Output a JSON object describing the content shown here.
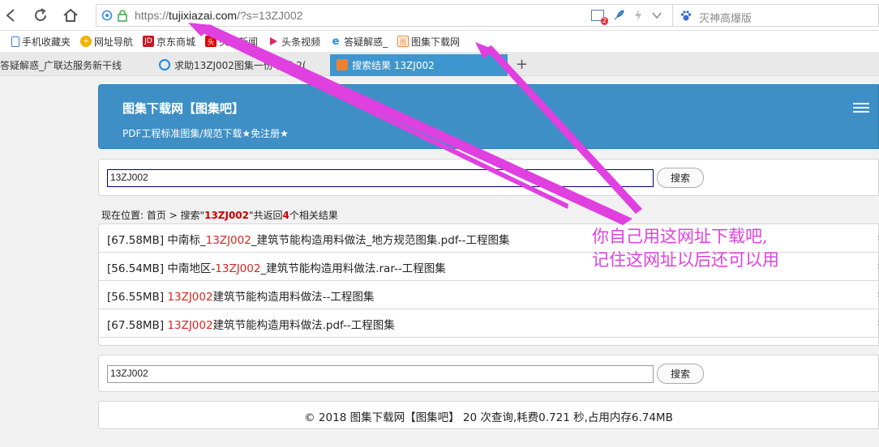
{
  "browser": {
    "url_prefix": "https://",
    "url_host": "tujixiazai.com",
    "url_path": "/?s=13ZJ002",
    "search_engine_text": "灭神高爆版",
    "badge_count": "2"
  },
  "bookmarks": [
    {
      "label": "手机收藏夹",
      "icon": "phone-icon",
      "color": "#3a7bd5"
    },
    {
      "label": "网址导航",
      "icon": "navigation-icon",
      "color": "#f0b400"
    },
    {
      "label": "京东商城",
      "icon": "jd-logo-icon",
      "color": "#c81623"
    },
    {
      "label": "头条新闻",
      "icon": "toutiao-icon",
      "color": "#d00"
    },
    {
      "label": "头条视频",
      "icon": "video-play-icon",
      "color": "#e0245e"
    },
    {
      "label": "答疑解惑_",
      "icon": "ie-logo-icon",
      "color": "#1e88e5"
    },
    {
      "label": "图集下载网",
      "icon": "tuji-favicon-icon",
      "color": "#f08030"
    }
  ],
  "tabs": [
    {
      "label": "答疑解惑_广联达服务新干线"
    },
    {
      "label": "求助13ZJ002图集一份书籍-2("
    },
    {
      "label": "搜索结果 13ZJ002"
    }
  ],
  "page": {
    "site_title": "图集下载网【图集吧】",
    "site_subtitle": "PDF工程标准图集/规范下载★免注册★",
    "search_value": "13ZJ002",
    "search_button": "搜索",
    "crumb_prefix": "现在位置: ",
    "crumb_home": "首页",
    "crumb_mid": " > 搜索\"",
    "crumb_keyword": "13ZJ002",
    "crumb_after": "\"共返回",
    "crumb_count": "4",
    "crumb_suffix": "个相关结果",
    "results": [
      {
        "pre": "[67.58MB] 中南标_",
        "hl": "13ZJ002",
        "post": "_建筑节能构造用料做法_地方规范图集.pdf--工程图集"
      },
      {
        "pre": "[56.54MB] 中南地区-",
        "hl": "13ZJ002",
        "post": "_建筑节能构造用料做法.rar--工程图集"
      },
      {
        "pre": "[56.55MB] ",
        "hl": "13ZJ002",
        "post": "建筑节能构造用料做法--工程图集"
      },
      {
        "pre": "[67.58MB] ",
        "hl": "13ZJ002",
        "post": "建筑节能构造用料做法.pdf--工程图集"
      }
    ],
    "bottom_search_value": "13ZJ002",
    "bottom_search_button": "搜索",
    "footer": "© 2018  图集下载网【图集吧】  20 次查询,耗费0.721 秒,占用内存6.74MB"
  },
  "annotation": {
    "line1": "你自己用这网址下载吧,",
    "line2": "记住这网址以后还可以用",
    "color": "#e040e0"
  }
}
